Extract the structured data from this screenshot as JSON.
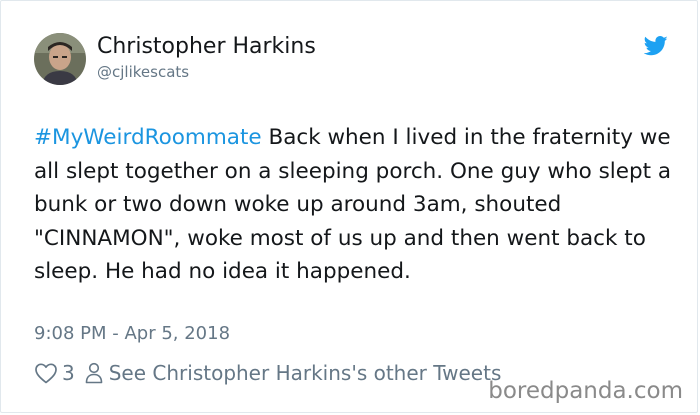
{
  "tweet": {
    "author_name": "Christopher Harkins",
    "author_handle": "@cjlikescats",
    "hashtag": "#MyWeirdRoommate",
    "body": " Back when I lived in the fraternity we all slept together on a sleeping porch. One guy who slept a bunk or two down woke up around 3am, shouted \"CINNAMON\", woke most of us up and then went back to sleep. He had no idea it happened.",
    "timestamp": "9:08 PM - Apr 5, 2018",
    "like_count": "3",
    "other_tweets_link": "See Christopher Harkins's other Tweets"
  },
  "watermark": "boredpanda.com",
  "icons": {
    "bird": "twitter-bird-icon",
    "heart": "heart-icon",
    "person": "person-icon"
  },
  "colors": {
    "hashtag": "#1b95e0",
    "bird": "#1da1f2",
    "muted": "#657786",
    "text": "#14171a"
  }
}
